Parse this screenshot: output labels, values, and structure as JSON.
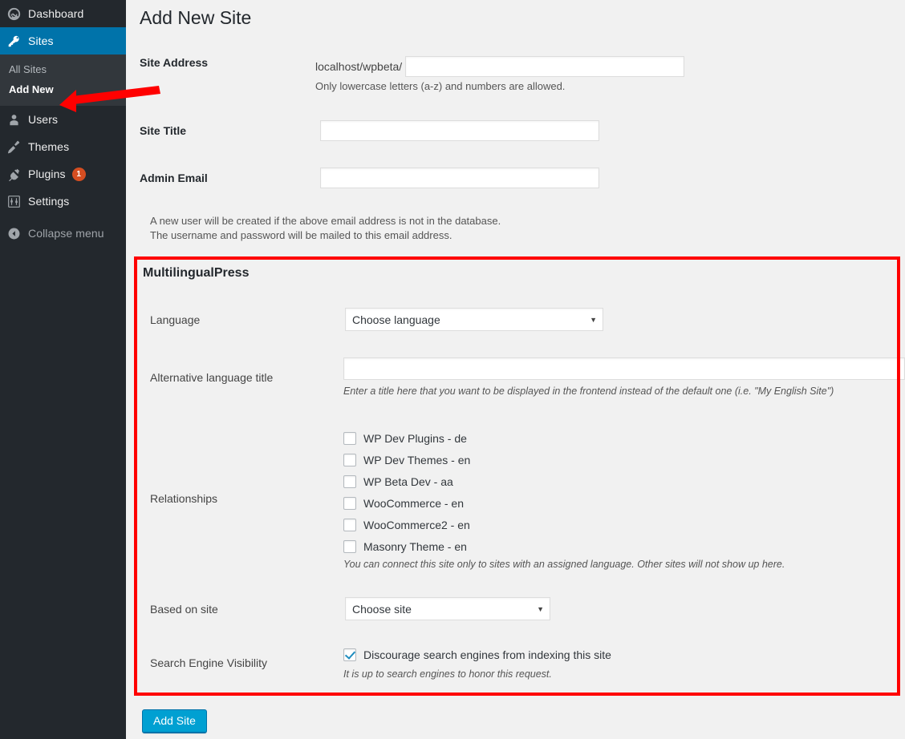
{
  "sidebar": {
    "items": [
      {
        "label": "Dashboard",
        "icon": "dashboard-icon",
        "current": false
      },
      {
        "label": "Sites",
        "icon": "key-icon",
        "current": true
      },
      {
        "label": "Users",
        "icon": "user-icon",
        "current": false
      },
      {
        "label": "Themes",
        "icon": "brush-icon",
        "current": false
      },
      {
        "label": "Plugins",
        "icon": "plug-icon",
        "current": false,
        "badge": "1"
      },
      {
        "label": "Settings",
        "icon": "sliders-icon",
        "current": false
      }
    ],
    "submenu": [
      {
        "label": "All Sites",
        "current": false
      },
      {
        "label": "Add New",
        "current": true
      }
    ],
    "collapse": {
      "label": "Collapse menu",
      "icon": "collapse-arrow-icon"
    }
  },
  "page": {
    "title": "Add New Site"
  },
  "form": {
    "site_address": {
      "label": "Site Address",
      "prefix": "localhost/wpbeta/",
      "value": "",
      "hint": "Only lowercase letters (a-z) and numbers are allowed."
    },
    "site_title": {
      "label": "Site Title",
      "value": ""
    },
    "admin_email": {
      "label": "Admin Email",
      "value": ""
    },
    "notice_line1": "A new user will be created if the above email address is not in the database.",
    "notice_line2": "The username and password will be mailed to this email address."
  },
  "mlp": {
    "title": "MultilingualPress",
    "language": {
      "label": "Language",
      "selected": "Choose language"
    },
    "alt_title": {
      "label": "Alternative language title",
      "value": "",
      "hint": "Enter a title here that you want to be displayed in the frontend instead of the default one (i.e. \"My English Site\")"
    },
    "relationships": {
      "label": "Relationships",
      "options": [
        {
          "label": "WP Dev Plugins - de",
          "checked": false
        },
        {
          "label": "WP Dev Themes - en",
          "checked": false
        },
        {
          "label": "WP Beta Dev - aa",
          "checked": false
        },
        {
          "label": "WooCommerce - en",
          "checked": false
        },
        {
          "label": "WooCommerce2 - en",
          "checked": false
        },
        {
          "label": "Masonry Theme - en",
          "checked": false
        }
      ],
      "hint": "You can connect this site only to sites with an assigned language. Other sites will not show up here."
    },
    "based_on_site": {
      "label": "Based on site",
      "selected": "Choose site"
    },
    "search_engine_visibility": {
      "label": "Search Engine Visibility",
      "checkbox_label": "Discourage search engines from indexing this site",
      "checked": true,
      "hint": "It is up to search engines to honor this request."
    }
  },
  "actions": {
    "submit_label": "Add Site"
  },
  "colors": {
    "sidebar_bg": "#23282d",
    "submenu_bg": "#32373c",
    "accent_blue": "#0073aa",
    "button_blue": "#00a0d2",
    "badge_orange": "#d54e21",
    "annotation_red": "#ff0000",
    "checkmark_blue": "#1e8cbe"
  }
}
